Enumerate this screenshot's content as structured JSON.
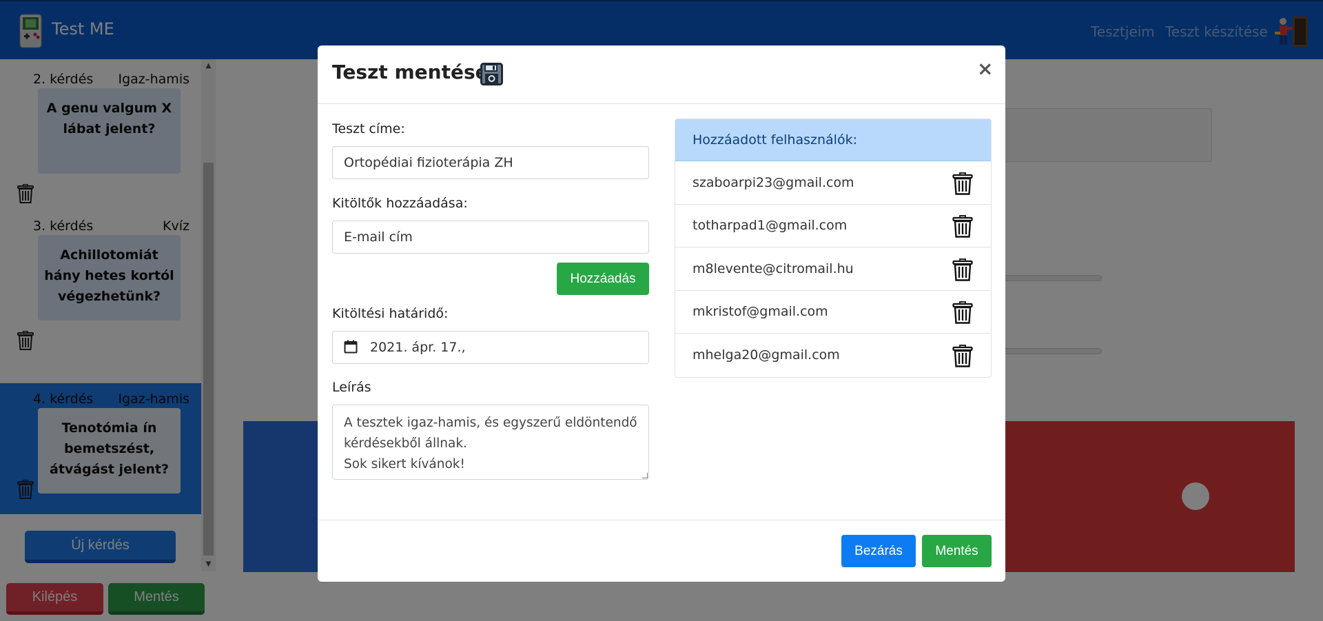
{
  "app": {
    "title": "Test ME"
  },
  "nav": {
    "my_tests": "Tesztjeim",
    "create_test": "Teszt készítése"
  },
  "sidebar": {
    "questions": [
      {
        "number": "2. kérdés",
        "type": "Igaz-hamis",
        "text": "A genu valgum X lábat jelent?",
        "active": false
      },
      {
        "number": "3. kérdés",
        "type": "Kvíz",
        "text": "Achillotomiát hány hetes kortól végezhetünk?",
        "active": false
      },
      {
        "number": "4. kérdés",
        "type": "Igaz-hamis",
        "text": "Tenotómia ín bemetszést, átvágást jelent?",
        "active": true
      }
    ],
    "new_question_label": "Új kérdés",
    "exit_label": "Kilépés",
    "save_label": "Mentés"
  },
  "modal": {
    "title": "Teszt mentése",
    "close_symbol": "×",
    "test_title_label": "Teszt címe:",
    "test_title_value": "Ortopédiai fizioterápia ZH",
    "add_takers_label": "Kitöltők hozzáadása:",
    "email_placeholder": "E-mail cím",
    "add_button": "Hozzáadás",
    "deadline_label": "Kitöltési határidő:",
    "deadline_value": "2021. ápr. 17.,",
    "description_label": "Leírás",
    "description_value": "A tesztek igaz-hamis, és egyszerű eldöntendő kérdésekből állnak.\nSok sikert kívánok!",
    "users_header": "Hozzáadott felhasználók:",
    "users": [
      "szaboarpi23@gmail.com",
      "totharpad1@gmail.com",
      "m8levente@citromail.hu",
      "mkristof@gmail.com",
      "mhelga20@gmail.com"
    ],
    "close_button": "Bezárás",
    "save_button": "Mentés"
  },
  "colors": {
    "navbar": "#0b5ccf",
    "primary": "#0d7cf2",
    "success": "#28a745",
    "danger": "#e0434f",
    "users_header_bg": "#b8d9fb"
  },
  "icons": {
    "brand": "gameboy-icon",
    "logout": "exit-door-icon",
    "save": "floppy-disk-icon",
    "calendar": "calendar-icon",
    "delete": "trash-icon"
  }
}
